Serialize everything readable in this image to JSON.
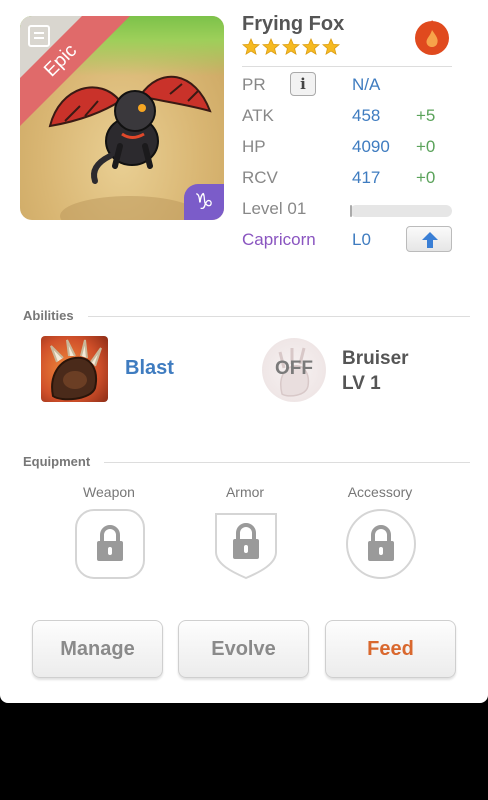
{
  "monster": {
    "name": "Frying Fox",
    "rarity": "Epic",
    "stars": 5,
    "element_icon": "fire-icon",
    "zodiac_symbol": "♑"
  },
  "stats": {
    "pr": {
      "label": "PR",
      "value": "N/A",
      "info_icon": "i"
    },
    "atk": {
      "label": "ATK",
      "value": "458",
      "bonus": "+5"
    },
    "hp": {
      "label": "HP",
      "value": "4090",
      "bonus": "+0"
    },
    "rcv": {
      "label": "RCV",
      "value": "417",
      "bonus": "+0"
    },
    "level": {
      "label": "Level 01",
      "progress": 0.02
    },
    "zodiac": {
      "label": "Capricorn",
      "value": "L0"
    }
  },
  "abilities": {
    "heading": "Abilities",
    "active": {
      "name": "Blast"
    },
    "passive": {
      "status": "OFF",
      "name_line1": "Bruiser",
      "name_line2": "LV 1"
    }
  },
  "equipment": {
    "heading": "Equipment",
    "slots": [
      {
        "label": "Weapon",
        "locked": true
      },
      {
        "label": "Armor",
        "locked": true
      },
      {
        "label": "Accessory",
        "locked": true
      }
    ]
  },
  "actions": {
    "manage": "Manage",
    "evolve": "Evolve",
    "feed": "Feed"
  },
  "colors": {
    "stat_value": "#3f7cc0",
    "bonus": "#5ba35b",
    "zodiac": "#8a55c0",
    "feed": "#d9682e",
    "epic_ribbon": "#e06a6a"
  }
}
